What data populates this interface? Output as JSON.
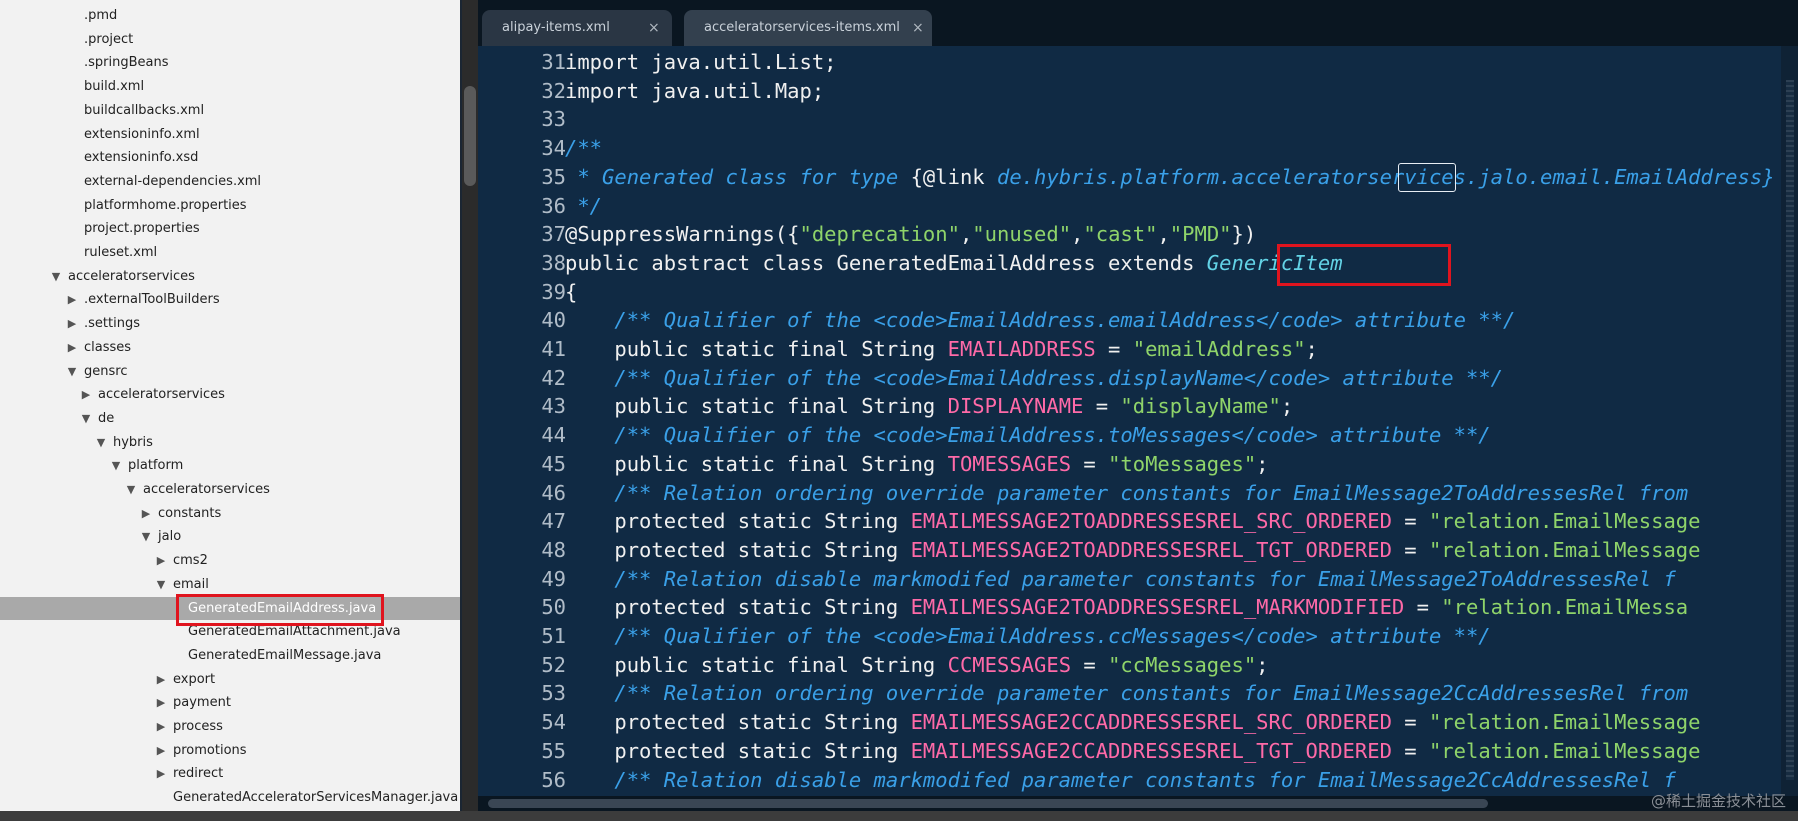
{
  "sidebar": {
    "items": [
      {
        "label": ".pmd",
        "arrow": ""
      },
      {
        "label": ".project",
        "arrow": ""
      },
      {
        "label": ".springBeans",
        "arrow": ""
      },
      {
        "label": "build.xml",
        "arrow": ""
      },
      {
        "label": "buildcallbacks.xml",
        "arrow": ""
      },
      {
        "label": "extensioninfo.xml",
        "arrow": ""
      },
      {
        "label": "extensioninfo.xsd",
        "arrow": ""
      },
      {
        "label": "external-dependencies.xml",
        "arrow": ""
      },
      {
        "label": "platformhome.properties",
        "arrow": ""
      },
      {
        "label": "project.properties",
        "arrow": ""
      },
      {
        "label": "ruleset.xml",
        "arrow": ""
      },
      {
        "label": "acceleratorservices",
        "arrow": "▼"
      },
      {
        "label": ".externalToolBuilders",
        "arrow": "▶"
      },
      {
        "label": ".settings",
        "arrow": "▶"
      },
      {
        "label": "classes",
        "arrow": "▶"
      },
      {
        "label": "gensrc",
        "arrow": "▼"
      },
      {
        "label": "acceleratorservices",
        "arrow": "▶"
      },
      {
        "label": "de",
        "arrow": "▼"
      },
      {
        "label": "hybris",
        "arrow": "▼"
      },
      {
        "label": "platform",
        "arrow": "▼"
      },
      {
        "label": "acceleratorservices",
        "arrow": "▼"
      },
      {
        "label": "constants",
        "arrow": "▶"
      },
      {
        "label": "jalo",
        "arrow": "▼"
      },
      {
        "label": "cms2",
        "arrow": "▶"
      },
      {
        "label": "email",
        "arrow": "▼"
      },
      {
        "label": "GeneratedEmailAddress.java",
        "arrow": ""
      },
      {
        "label": "GeneratedEmailAttachment.java",
        "arrow": ""
      },
      {
        "label": "GeneratedEmailMessage.java",
        "arrow": ""
      },
      {
        "label": "export",
        "arrow": "▶"
      },
      {
        "label": "payment",
        "arrow": "▶"
      },
      {
        "label": "process",
        "arrow": "▶"
      },
      {
        "label": "promotions",
        "arrow": "▶"
      },
      {
        "label": "redirect",
        "arrow": "▶"
      },
      {
        "label": "GeneratedAcceleratorServicesManager.java",
        "arrow": ""
      }
    ]
  },
  "tabs": [
    {
      "label": "alipay-items.xml",
      "close": "×"
    },
    {
      "label": "acceleratorservices-items.xml",
      "close": "×"
    }
  ],
  "code": {
    "lines": [
      {
        "num": "31",
        "segs": [
          [
            "k",
            "import java.util.List;"
          ]
        ]
      },
      {
        "num": "32",
        "segs": [
          [
            "k",
            "import java.util.Map;"
          ]
        ]
      },
      {
        "num": "33",
        "segs": []
      },
      {
        "num": "34",
        "segs": [
          [
            "c",
            "/**"
          ]
        ]
      },
      {
        "num": "35",
        "segs": [
          [
            "c",
            " * Generated class for type "
          ],
          [
            "k",
            "{@link "
          ],
          [
            "c",
            "de.hybris.platform.acceleratorservices.jalo.email.EmailAddress}"
          ]
        ]
      },
      {
        "num": "36",
        "segs": [
          [
            "c",
            " */"
          ]
        ]
      },
      {
        "num": "37",
        "segs": [
          [
            "k",
            "@SuppressWarnings({"
          ],
          [
            "s",
            "\"deprecation\""
          ],
          [
            "k",
            ","
          ],
          [
            "s",
            "\"unused\""
          ],
          [
            "k",
            ","
          ],
          [
            "s",
            "\"cast\""
          ],
          [
            "k",
            ","
          ],
          [
            "s",
            "\"PMD\""
          ],
          [
            "k",
            "})"
          ]
        ]
      },
      {
        "num": "38",
        "segs": [
          [
            "k",
            "public abstract class GeneratedEmailAddress extends "
          ],
          [
            "g",
            "GenericItem"
          ]
        ]
      },
      {
        "num": "39",
        "segs": [
          [
            "k",
            "{"
          ]
        ]
      },
      {
        "num": "40",
        "segs": [
          [
            "c",
            "    /** Qualifier of the <code>EmailAddress.emailAddress</code> attribute **/"
          ]
        ]
      },
      {
        "num": "41",
        "segs": [
          [
            "k",
            "    public static final String "
          ],
          [
            "n",
            "EMAILADDRESS"
          ],
          [
            "k",
            " = "
          ],
          [
            "s",
            "\"emailAddress\""
          ],
          [
            "k",
            ";"
          ]
        ]
      },
      {
        "num": "42",
        "segs": [
          [
            "c",
            "    /** Qualifier of the <code>EmailAddress.displayName</code> attribute **/"
          ]
        ]
      },
      {
        "num": "43",
        "segs": [
          [
            "k",
            "    public static final String "
          ],
          [
            "n",
            "DISPLAYNAME"
          ],
          [
            "k",
            " = "
          ],
          [
            "s",
            "\"displayName\""
          ],
          [
            "k",
            ";"
          ]
        ]
      },
      {
        "num": "44",
        "segs": [
          [
            "c",
            "    /** Qualifier of the <code>EmailAddress.toMessages</code> attribute **/"
          ]
        ]
      },
      {
        "num": "45",
        "segs": [
          [
            "k",
            "    public static final String "
          ],
          [
            "n",
            "TOMESSAGES"
          ],
          [
            "k",
            " = "
          ],
          [
            "s",
            "\"toMessages\""
          ],
          [
            "k",
            ";"
          ]
        ]
      },
      {
        "num": "46",
        "segs": [
          [
            "c",
            "    /** Relation ordering override parameter constants for EmailMessage2ToAddressesRel from"
          ]
        ]
      },
      {
        "num": "47",
        "segs": [
          [
            "k",
            "    protected static String "
          ],
          [
            "n",
            "EMAILMESSAGE2TOADDRESSESREL_SRC_ORDERED"
          ],
          [
            "k",
            " = "
          ],
          [
            "s",
            "\"relation.EmailMessage"
          ]
        ]
      },
      {
        "num": "48",
        "segs": [
          [
            "k",
            "    protected static String "
          ],
          [
            "n",
            "EMAILMESSAGE2TOADDRESSESREL_TGT_ORDERED"
          ],
          [
            "k",
            " = "
          ],
          [
            "s",
            "\"relation.EmailMessage"
          ]
        ]
      },
      {
        "num": "49",
        "segs": [
          [
            "c",
            "    /** Relation disable markmodifed parameter constants for EmailMessage2ToAddressesRel f"
          ]
        ]
      },
      {
        "num": "50",
        "segs": [
          [
            "k",
            "    protected static String "
          ],
          [
            "n",
            "EMAILMESSAGE2TOADDRESSESREL_MARKMODIFIED"
          ],
          [
            "k",
            " = "
          ],
          [
            "s",
            "\"relation.EmailMessa"
          ]
        ]
      },
      {
        "num": "51",
        "segs": [
          [
            "c",
            "    /** Qualifier of the <code>EmailAddress.ccMessages</code> attribute **/"
          ]
        ]
      },
      {
        "num": "52",
        "segs": [
          [
            "k",
            "    public static final String "
          ],
          [
            "n",
            "CCMESSAGES"
          ],
          [
            "k",
            " = "
          ],
          [
            "s",
            "\"ccMessages\""
          ],
          [
            "k",
            ";"
          ]
        ]
      },
      {
        "num": "53",
        "segs": [
          [
            "c",
            "    /** Relation ordering override parameter constants for EmailMessage2CcAddressesRel from"
          ]
        ]
      },
      {
        "num": "54",
        "segs": [
          [
            "k",
            "    protected static String "
          ],
          [
            "n",
            "EMAILMESSAGE2CCADDRESSESREL_SRC_ORDERED"
          ],
          [
            "k",
            " = "
          ],
          [
            "s",
            "\"relation.EmailMessage"
          ]
        ]
      },
      {
        "num": "55",
        "segs": [
          [
            "k",
            "    protected static String "
          ],
          [
            "n",
            "EMAILMESSAGE2CCADDRESSESREL_TGT_ORDERED"
          ],
          [
            "k",
            " = "
          ],
          [
            "s",
            "\"relation.EmailMessage"
          ]
        ]
      },
      {
        "num": "56",
        "segs": [
          [
            "c",
            "    /** Relation disable markmodifed parameter constants for EmailMessage2CcAddressesRel f"
          ]
        ]
      }
    ]
  },
  "watermark": "@稀土掘金技术社区",
  "colors": {
    "keyword": "#f0f0f0",
    "string": "#8fd46a",
    "comment": "#3aa0e8",
    "constant": "#ff6aa8",
    "type": "#63d3e6",
    "highlight": "#e0141e"
  }
}
